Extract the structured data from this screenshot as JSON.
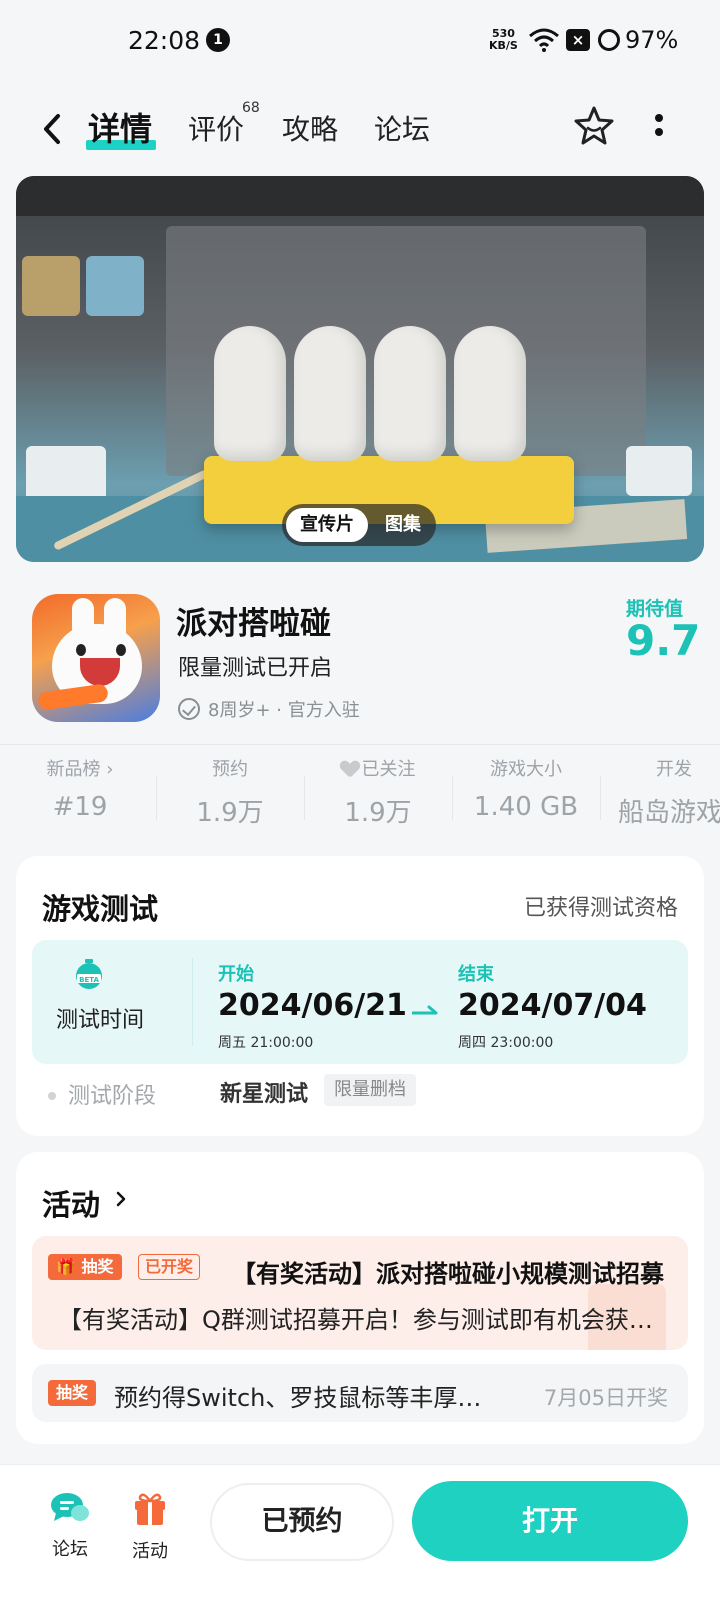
{
  "status_bar": {
    "time": "22:08",
    "notification_count": "1",
    "net_speed_value": "530",
    "net_speed_unit": "KB/S",
    "battery": "97%"
  },
  "nav": {
    "tabs": [
      {
        "label": "详情",
        "active": true
      },
      {
        "label": "评价",
        "badge": "68"
      },
      {
        "label": "攻略"
      },
      {
        "label": "论坛"
      }
    ]
  },
  "hero": {
    "switch": {
      "video": "宣传片",
      "gallery": "图集"
    }
  },
  "game": {
    "title": "派对搭啦碰",
    "subtitle": "限量测试已开启",
    "meta": "8周岁+ · 官方入驻",
    "expect_label": "期待值",
    "expect_value": "9.7"
  },
  "stats": [
    {
      "label": "新品榜 ›",
      "value": "#19"
    },
    {
      "label": "预约",
      "value": "1.9万"
    },
    {
      "label": "已关注",
      "value": "1.9万"
    },
    {
      "label": "游戏大小",
      "value": "1.40 GB"
    },
    {
      "label": "开发",
      "value": "船岛游戏"
    }
  ],
  "test": {
    "title": "游戏测试",
    "status": "已获得测试资格",
    "box_label": "测试时间",
    "start_label": "开始",
    "start_date": "2024/06/21",
    "start_time": "周五  21:00:00",
    "end_label": "结束",
    "end_date": "2024/07/04",
    "end_time": "周四  23:00:00",
    "phase_label": "测试阶段",
    "phase_value": "新星测试",
    "phase_tag": "限量删档"
  },
  "activity": {
    "title": "活动",
    "item1": {
      "badge": "抽奖",
      "status": "已开奖",
      "title": "【有奖活动】派对搭啦碰小规模测试招募",
      "desc": "【有奖活动】Q群测试招募开启！参与测试即有机会获得好礼"
    },
    "item2": {
      "badge": "抽奖",
      "text": "预约得Switch、罗技鼠标等丰厚好礼",
      "date": "7月05日开奖"
    }
  },
  "bottom": {
    "forum": "论坛",
    "activity": "活动",
    "reserved": "已预约",
    "open": "打开"
  },
  "colors": {
    "accent": "#1ed1c0",
    "lottery": "#f46a3a"
  }
}
